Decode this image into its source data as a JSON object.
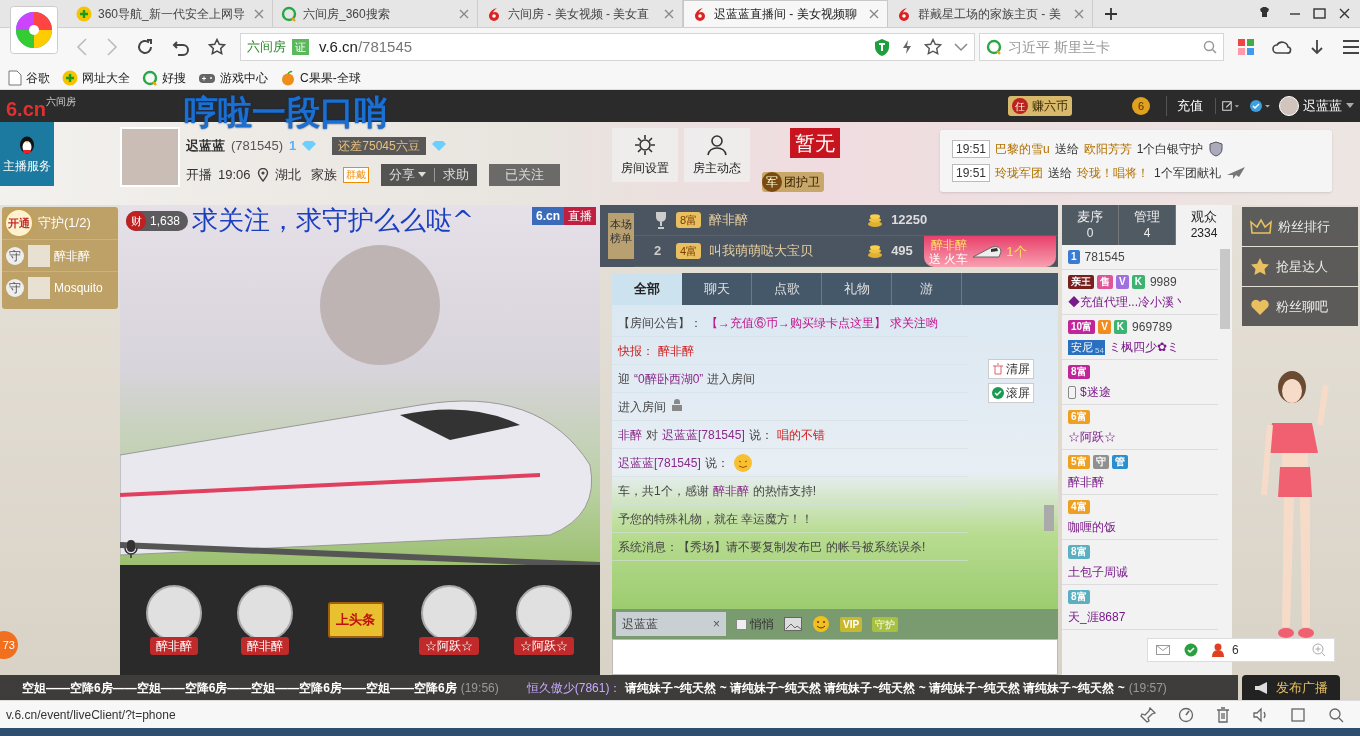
{
  "browser": {
    "tabs": [
      {
        "kind": "nav",
        "title": "360导航_新一代安全上网导",
        "selected": false
      },
      {
        "kind": "search",
        "title": "六间房_360搜索",
        "selected": false
      },
      {
        "kind": "six",
        "title": "六间房 - 美女视频 - 美女直",
        "selected": false
      },
      {
        "kind": "six",
        "title": "迟蓝蓝直播间 - 美女视频聊",
        "selected": true
      },
      {
        "kind": "six",
        "title": "群戴星工场的家族主页 - 美",
        "selected": false
      }
    ],
    "address": {
      "site_label": "六间房",
      "verified_badge": "证",
      "host": "v.6.cn",
      "path": "/781545"
    },
    "search": {
      "placeholder": "习近平 斯里兰卡"
    },
    "bookmarks": [
      {
        "kind": "page",
        "label": "谷歌"
      },
      {
        "kind": "nav",
        "label": "网址大全"
      },
      {
        "kind": "search",
        "label": "好搜"
      },
      {
        "kind": "game",
        "label": "游戏中心"
      },
      {
        "kind": "fruit",
        "label": "C果果-全球"
      }
    ],
    "status_url": "v.6.cn/event/liveClient/?t=phone"
  },
  "site_bar": {
    "logo": "6.cn",
    "logo_small": "六间房",
    "earn_badge": "任",
    "earn": "赚六币",
    "coin_badge": "6",
    "recharge": "充值",
    "user": "迟蓝蓝"
  },
  "room": {
    "title": "哼啦一段口哨",
    "anchor_name": "迟蓝蓝",
    "room_id": "(781545)",
    "level": "1",
    "upgrade_note": "还差75045六豆",
    "start_label": "开播",
    "start_time": "19:06",
    "location": "湖北",
    "family_label": "家族",
    "family_badge": "群戴",
    "share": "分享",
    "help": "求助",
    "follow": "已关注",
    "tools": [
      {
        "kind": "gear",
        "label": "房间设置"
      },
      {
        "kind": "person",
        "label": "房主动态"
      }
    ],
    "guard_title": "暂无",
    "guard_badge": "军",
    "guard_label": "团护卫",
    "gift_notices": [
      {
        "kind": "shield",
        "time": "19:51",
        "sender": "巴黎的雪u",
        "verb": "送给",
        "receiver": "欧阳芳芳",
        "gift": "1个白银守护"
      },
      {
        "kind": "plane",
        "time": "19:51",
        "sender": "玲珑军团",
        "verb": "送给",
        "receiver": "玲珑！唱将！",
        "gift": "1个军团献礼"
      }
    ]
  },
  "anchor_service": "主播服务",
  "guard_panel": {
    "open": "开通",
    "title": "守护(1/2)",
    "guards": [
      {
        "badge": "守",
        "name": "醉非醉"
      },
      {
        "badge": "守",
        "name": "Mosquito"
      }
    ]
  },
  "video": {
    "fans_badge": "财",
    "fans": "1,638",
    "caption": "求关注，求守护么么哒^",
    "brand": "6.cn",
    "live": "直播"
  },
  "mic_seats": [
    {
      "kind": "guest",
      "name": "醉非醉"
    },
    {
      "kind": "guest",
      "name": "醉非醉"
    },
    {
      "kind": "sign",
      "name": "上头条"
    },
    {
      "kind": "guest",
      "name": "☆阿跃☆"
    },
    {
      "kind": "guest",
      "name": "☆阿跃☆"
    }
  ],
  "ranking": {
    "label": "本场榜单",
    "rows": [
      {
        "kind": "trophy",
        "badge": "8富",
        "name": "醉非醉",
        "amount": "12250"
      },
      {
        "kind": "number",
        "rank": "2",
        "badge": "4富",
        "name": "叫我萌萌哒大宝贝",
        "amount": "495"
      }
    ]
  },
  "chat": {
    "tabs": [
      {
        "label": "全部",
        "selected": true
      },
      {
        "label": "聊天",
        "selected": false
      },
      {
        "label": "点歌",
        "selected": false
      },
      {
        "label": "礼物",
        "selected": false
      },
      {
        "label": "游",
        "selected": false
      }
    ],
    "messages": [
      {
        "kind": "text",
        "parts": [
          {
            "kind": "label",
            "text": "【房间公告】："
          },
          {
            "kind": "link",
            "text": "【→充值⑥币→购买绿卡点这里】"
          },
          {
            "kind": "link",
            "text": "求关注哟"
          }
        ]
      },
      {
        "kind": "text",
        "parts": [
          {
            "kind": "alert",
            "text": "快报："
          },
          {
            "kind": "alert",
            "text": "醉非醉"
          }
        ]
      },
      {
        "kind": "text",
        "parts": [
          {
            "kind": "text",
            "text": "迎"
          },
          {
            "kind": "name",
            "text": "“0醉卧西湖0”"
          },
          {
            "kind": "text",
            "text": "进入房间"
          }
        ]
      },
      {
        "kind": "mobile_entry",
        "parts": [
          {
            "kind": "text",
            "text": "进入房间"
          }
        ]
      },
      {
        "kind": "text",
        "parts": [
          {
            "kind": "name",
            "text": "非醉"
          },
          {
            "kind": "text",
            "text": "对"
          },
          {
            "kind": "name",
            "text": "迟蓝蓝[781545]"
          },
          {
            "kind": "text",
            "text": "说："
          },
          {
            "kind": "alert",
            "text": "唱的不错"
          }
        ]
      },
      {
        "kind": "emoji_message",
        "parts": [
          {
            "kind": "name",
            "text": "迟蓝蓝[781545]"
          },
          {
            "kind": "text",
            "text": "说："
          }
        ]
      },
      {
        "kind": "text",
        "parts": [
          {
            "kind": "text",
            "text": "车，共1个，感谢"
          },
          {
            "kind": "name",
            "text": "醉非醉"
          },
          {
            "kind": "text",
            "text": "的热情支持!"
          }
        ]
      },
      {
        "kind": "text",
        "parts": [
          {
            "kind": "text",
            "text": "予您的特殊礼物，就在 幸运魔方！！"
          }
        ]
      },
      {
        "kind": "text",
        "parts": [
          {
            "kind": "text",
            "text": "系统消息：【秀场】请不要复制发布巴"
          },
          {
            "kind": "text",
            "text": "的帐号被系统误杀!"
          }
        ]
      }
    ],
    "clear": "清屏",
    "scroll": {
      "label": "滚屏",
      "checked": true
    },
    "input": {
      "target": "迟蓝蓝",
      "clear": "×",
      "whisper": {
        "label": "悄悄",
        "checked": false
      },
      "vip": "VIP",
      "guard": "守护"
    }
  },
  "gift_banner": {
    "sender": "醉非醉",
    "action": "送 火车",
    "count": "1个"
  },
  "audience": {
    "tabs": [
      {
        "label": "麦序",
        "count": "0",
        "selected": false
      },
      {
        "label": "管理",
        "count": "4",
        "selected": false
      },
      {
        "label": "观众",
        "count": "2334",
        "selected": true
      }
    ],
    "users": [
      {
        "badges": [
          {
            "text": "1",
            "color": "#3a7bd5"
          }
        ],
        "id_text": "781545"
      },
      {
        "badges": [
          {
            "text": "亲王",
            "color": "#7a1f1f"
          },
          {
            "text": "售",
            "color": "#e0559a"
          },
          {
            "text": "V",
            "color": "#a070e0"
          },
          {
            "text": "K",
            "color": "#3cb371"
          }
        ],
        "id_text": "9989",
        "name": "◆充值代理...冷小溪丶"
      },
      {
        "badges": [
          {
            "text": "10富",
            "color": "#c0259a"
          },
          {
            "text": "V",
            "color": "#f08c20"
          },
          {
            "text": "K",
            "color": "#3cb371"
          }
        ],
        "id_text": "969789",
        "tag": "安尼",
        "tag_level": "54",
        "name": "ミ枫四少✿ミ"
      },
      {
        "device_icon": true,
        "badges": [
          {
            "text": "8富",
            "color": "#c0259a"
          }
        ],
        "name": "$迷途"
      },
      {
        "badges": [
          {
            "text": "6富",
            "color": "#f0a020"
          }
        ],
        "name": "☆阿跃☆"
      },
      {
        "badges": [
          {
            "text": "5富",
            "color": "#f0a020"
          },
          {
            "text": "守",
            "color": "#909090"
          },
          {
            "text": "管",
            "color": "#2a8fd0"
          }
        ],
        "name": "醉非醉"
      },
      {
        "badges": [
          {
            "text": "4富",
            "color": "#f0a020"
          }
        ],
        "name": "咖喱的饭"
      },
      {
        "badges": [
          {
            "text": "8富",
            "color": "#5ab0c0"
          }
        ],
        "name": "土包子周诚"
      },
      {
        "badges": [
          {
            "text": "8富",
            "color": "#5ab0c0"
          }
        ],
        "name": "天_涯8687"
      }
    ]
  },
  "right_menu": [
    {
      "kind": "crown",
      "label": "粉丝排行"
    },
    {
      "kind": "star",
      "label": "抢星达人"
    },
    {
      "kind": "heart",
      "label": "粉丝聊吧"
    }
  ],
  "mini_bar": {
    "online": "6"
  },
  "side_badge": "73",
  "ticker": {
    "first": "空姐——空降6房——空姐——空降6房——空姐——空降6房——空姐——空降6房",
    "first_time": "(19:56)",
    "sender": "恒久傲少(7861)：",
    "message": "请纯妹子~纯天然 ~ 请纯妹子~纯天然 请纯妹子~纯天然 ~ 请纯妹子~纯天然 请纯妹子~纯天然 ~",
    "time": "(19:57)",
    "publish": "发布广播"
  }
}
